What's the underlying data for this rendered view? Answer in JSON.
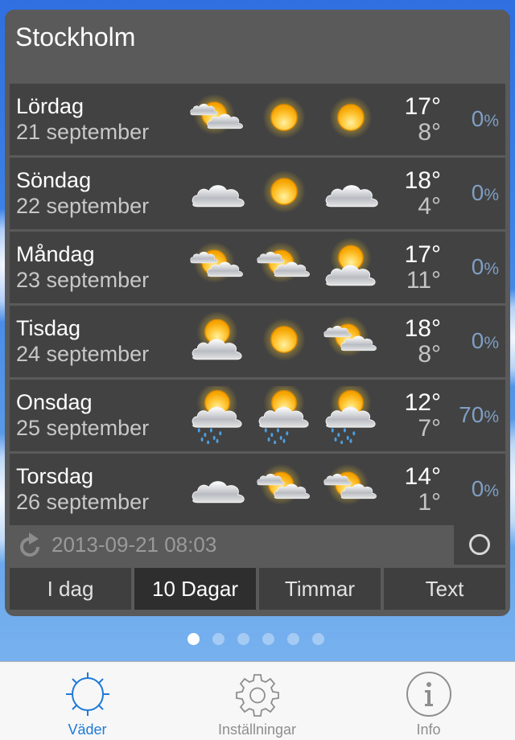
{
  "city": "Stockholm",
  "forecast": [
    {
      "day": "Lördag",
      "date": "21 september",
      "icons": [
        "sun-cloud-small-icon",
        "sun-icon",
        "sun-icon"
      ],
      "high": "17°",
      "low": "8°",
      "precip": "0",
      "precip_unit": "%"
    },
    {
      "day": "Söndag",
      "date": "22 september",
      "icons": [
        "cloud-icon",
        "sun-icon",
        "cloud-icon"
      ],
      "high": "18°",
      "low": "4°",
      "precip": "0",
      "precip_unit": "%"
    },
    {
      "day": "Måndag",
      "date": "23 september",
      "icons": [
        "sun-cloud-small-icon",
        "sun-cloud-small-icon",
        "sun-cloud-big-icon"
      ],
      "high": "17°",
      "low": "11°",
      "precip": "0",
      "precip_unit": "%"
    },
    {
      "day": "Tisdag",
      "date": "24 september",
      "icons": [
        "sun-cloud-big-icon",
        "sun-icon",
        "sun-cloud-small-icon"
      ],
      "high": "18°",
      "low": "8°",
      "precip": "0",
      "precip_unit": "%"
    },
    {
      "day": "Onsdag",
      "date": "25 september",
      "icons": [
        "sun-cloud-rain-icon",
        "sun-cloud-rain-icon",
        "sun-cloud-rain-icon"
      ],
      "high": "12°",
      "low": "7°",
      "precip": "70",
      "precip_unit": "%"
    },
    {
      "day": "Torsdag",
      "date": "26 september",
      "icons": [
        "cloud-icon",
        "sun-cloud-small-icon",
        "sun-cloud-small-icon"
      ],
      "high": "14°",
      "low": "1°",
      "precip": "0",
      "precip_unit": "%"
    }
  ],
  "updated": "2013-09-21 08:03",
  "view_tabs": [
    {
      "label": "I dag",
      "active": false
    },
    {
      "label": "10 Dagar",
      "active": true
    },
    {
      "label": "Timmar",
      "active": false
    },
    {
      "label": "Text",
      "active": false
    }
  ],
  "page_dots": {
    "count": 6,
    "active": 0
  },
  "tabbar": [
    {
      "label": "Väder",
      "icon": "sun-outline-icon",
      "active": true
    },
    {
      "label": "Inställningar",
      "icon": "gear-icon",
      "active": false
    },
    {
      "label": "Info",
      "icon": "info-icon",
      "active": false
    }
  ],
  "colors": {
    "accent": "#1f7ad6",
    "precip": "#7f9fc4",
    "panel": "#5a5a5a",
    "row": "#424242"
  }
}
